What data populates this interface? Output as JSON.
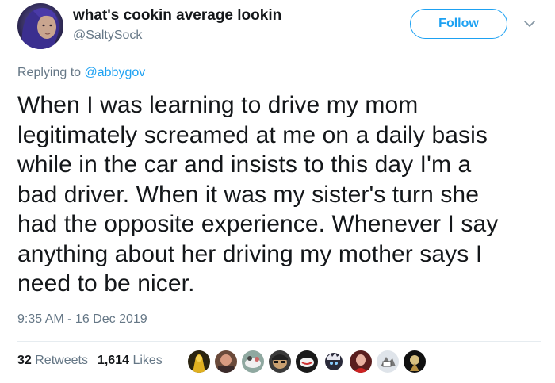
{
  "author": {
    "display_name": "what's cookin average lookin",
    "handle": "@SaltySock"
  },
  "follow_button": {
    "label": "Follow"
  },
  "reply_context": {
    "prefix": "Replying to",
    "mention": "@abbygov"
  },
  "tweet": {
    "text_lines": [
      "When I was learning to drive my mom",
      "legitimately screamed at me on a daily basis",
      "while in the car and insists to this day I'm a",
      "bad driver. When it was my sister's turn she",
      "had the opposite experience. Whenever I say",
      "anything about her driving my mother says I",
      "need to be nicer."
    ],
    "timestamp": "9:35 AM - 16 Dec 2019"
  },
  "stats": {
    "retweets_count": "32",
    "retweets_label": "Retweets",
    "likes_count": "1,614",
    "likes_label": "Likes"
  },
  "colors": {
    "accent": "#1da1f2",
    "text_primary": "#14171a",
    "text_secondary": "#657786",
    "divider": "#e6ecf0"
  },
  "icons": {
    "more_menu": "chevron-down-icon"
  }
}
